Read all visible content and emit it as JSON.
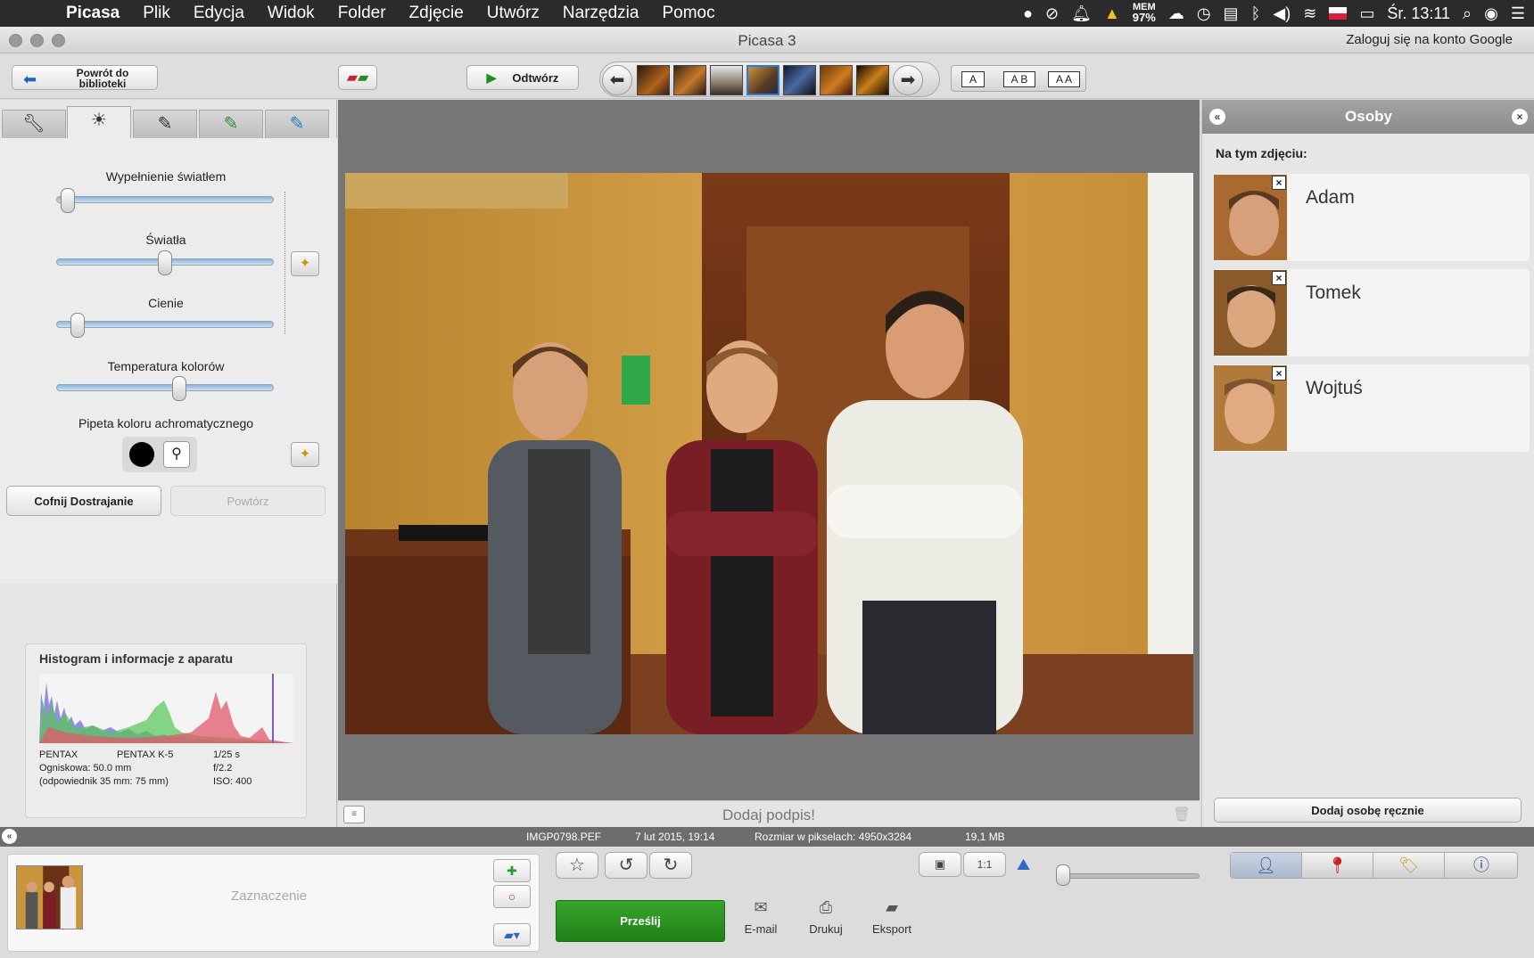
{
  "menubar": {
    "app": "Picasa",
    "items": [
      "Plik",
      "Edycja",
      "Widok",
      "Folder",
      "Zdjęcie",
      "Utwórz",
      "Narzędzia",
      "Pomoc"
    ],
    "mem_label": "MEM",
    "mem_value": "97%",
    "clock": "Śr. 13:11"
  },
  "window": {
    "title": "Picasa 3",
    "login_link": "Zaloguj się na konto Google"
  },
  "toolbar": {
    "back_label": "Powrót do biblioteki",
    "open_label": "Odtwórz",
    "view_modes": [
      "A",
      "A B",
      "A A"
    ]
  },
  "adjust": {
    "sliders": [
      {
        "label": "Wypełnienie światłem",
        "value": 0.02
      },
      {
        "label": "Światła",
        "value": 0.5
      },
      {
        "label": "Cienie",
        "value": 0.07
      },
      {
        "label": "Temperatura kolorów",
        "value": 0.57
      }
    ],
    "pipette_label": "Pipeta koloru achromatycznego",
    "undo_label": "Cofnij Dostrajanie",
    "redo_label": "Powtórz"
  },
  "histogram": {
    "title": "Histogram i informacje z aparatu",
    "make": "PENTAX",
    "model": "PENTAX K-5",
    "shutter": "1/25 s",
    "focal": "Ogniskowa: 50.0 mm",
    "aperture": "f/2.2",
    "equiv": "(odpowiednik 35 mm:  75 mm)",
    "iso": "ISO: 400"
  },
  "caption": {
    "placeholder": "Dodaj podpis!"
  },
  "people": {
    "panel_title": "Osoby",
    "subtitle": "Na tym zdjęciu:",
    "list": [
      {
        "name": "Adam"
      },
      {
        "name": "Tomek"
      },
      {
        "name": "Wojtuś"
      }
    ],
    "add_label": "Dodaj osobę ręcznie"
  },
  "status": {
    "filename": "IMGP0798.PEF",
    "date": "7 lut 2015, 19:14",
    "size_px": "Rozmiar w pikselach: 4950x3284",
    "file_size": "19,1 MB"
  },
  "bottom": {
    "selection_label": "Zaznaczenie",
    "send_label": "Prześlij",
    "actions": [
      "E-mail",
      "Drukuj",
      "Eksport"
    ],
    "zoom_1_1": "1:1"
  }
}
